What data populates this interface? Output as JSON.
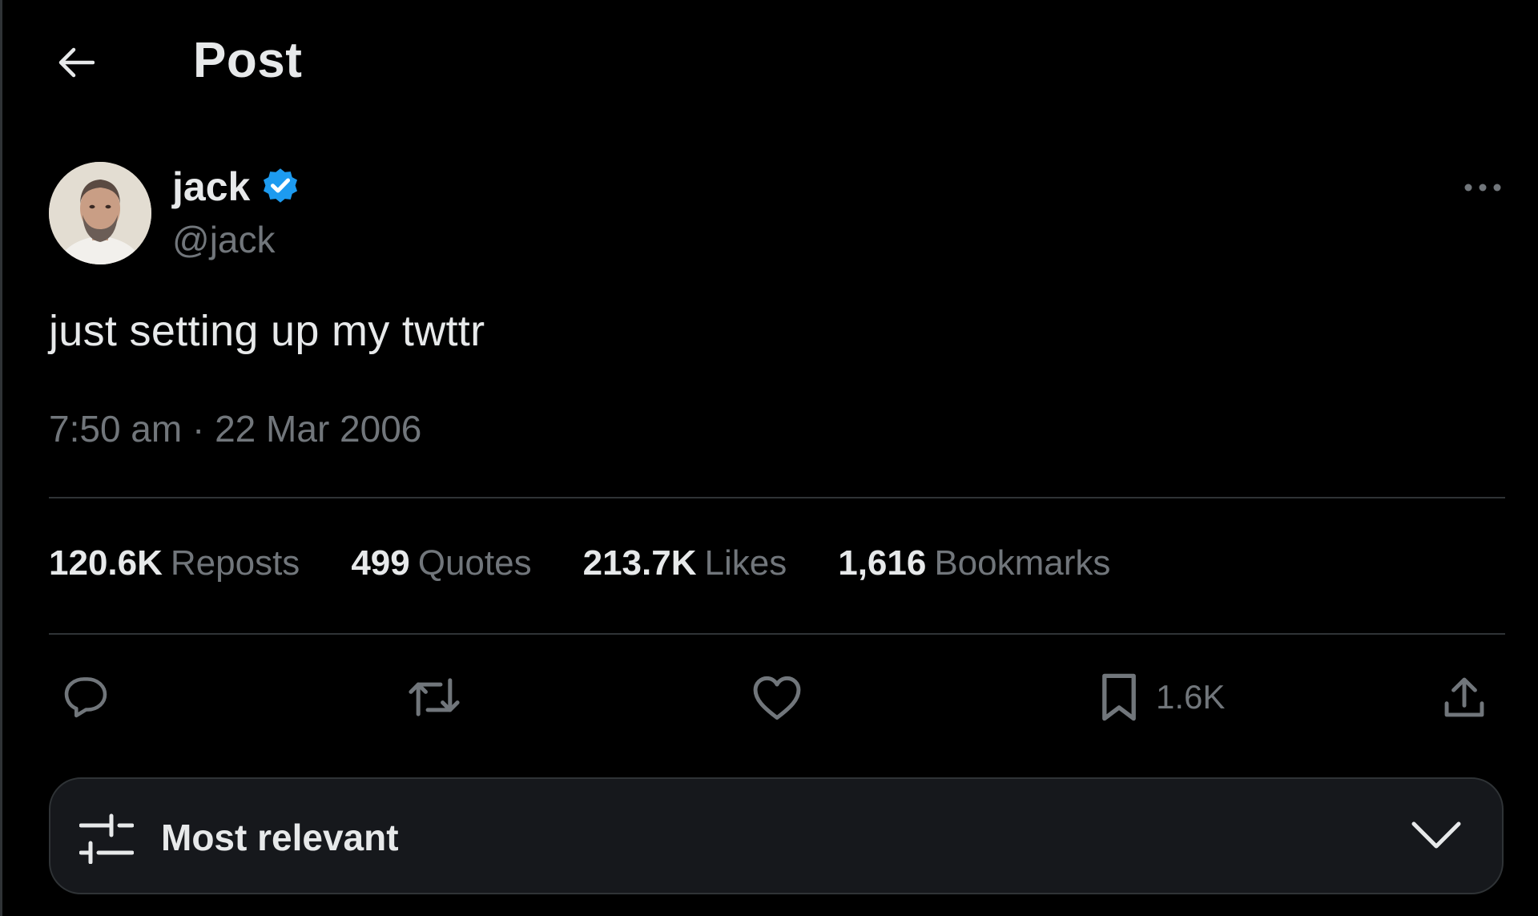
{
  "header": {
    "title": "Post",
    "back_icon": "arrow-left-icon"
  },
  "author": {
    "display_name": "jack",
    "handle": "@jack",
    "verified": true,
    "verified_color": "#1d9bf0"
  },
  "post": {
    "text": "just setting up my twttr",
    "timestamp": "7:50 am · 22 Mar 2006"
  },
  "stats": [
    {
      "value": "120.6K",
      "label": "Reposts"
    },
    {
      "value": "499",
      "label": "Quotes"
    },
    {
      "value": "213.7K",
      "label": "Likes"
    },
    {
      "value": "1,616",
      "label": "Bookmarks"
    }
  ],
  "actions": {
    "reply_icon": "reply-icon",
    "repost_icon": "repost-icon",
    "like_icon": "heart-icon",
    "bookmark_icon": "bookmark-icon",
    "bookmark_count": "1.6K",
    "share_icon": "share-icon"
  },
  "sort": {
    "label": "Most relevant",
    "icon": "sliders-icon",
    "chevron": "chevron-down-icon"
  },
  "colors": {
    "background": "#000000",
    "text_primary": "#e7e9ea",
    "text_secondary": "#71767b",
    "divider": "#2f3336",
    "accent": "#1d9bf0"
  }
}
